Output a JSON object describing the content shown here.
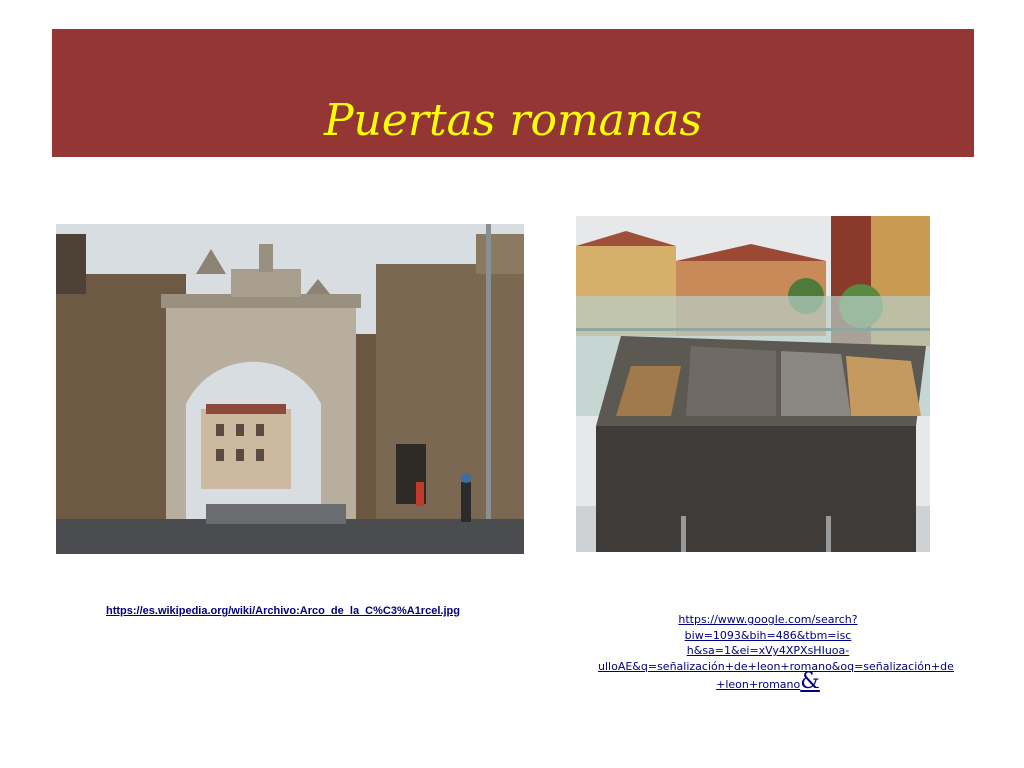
{
  "slide": {
    "title": "Puertas romanas",
    "colors": {
      "title_band": "#943634",
      "title_text": "#ffff00",
      "link_text": "#000080"
    }
  },
  "images": {
    "left": {
      "subject": "roman-arch-gate-photo"
    },
    "right": {
      "subject": "bronze-information-plaque-photo"
    }
  },
  "links": {
    "left": "https://es.wikipedia.org/wiki/Archivo:Arco_de_la_C%C3%A1rcel.jpg",
    "right_lines": [
      "https://www.google.com/search?biw=1093&bih=486&tbm=isc",
      "h&sa=1&ei=xVy4XPXsHIuoa-",
      "ulloAE&q=señalización+de+leon+romano&oq=señalización+de",
      "+leon+romano"
    ],
    "right_trailing": "&"
  }
}
